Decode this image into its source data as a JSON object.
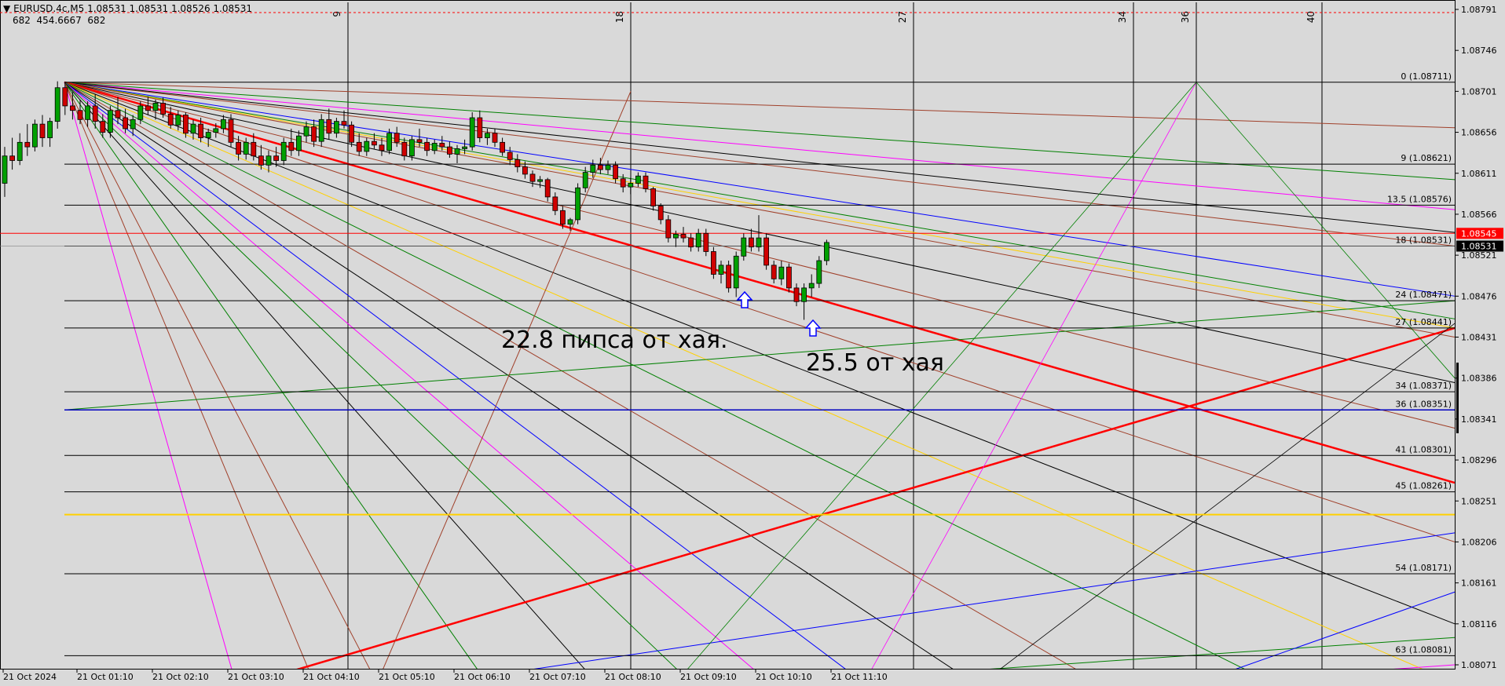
{
  "header": {
    "symbol": "EURUSD.4c,M5",
    "ohlc": "1.08531 1.08531 1.08526 1.08531",
    "indicator_values": "682  454.6667  682",
    "menu_marker": "▼"
  },
  "colors": {
    "background": "#d9d9d9",
    "bull_candle": "#00a000",
    "bear_candle": "#d00000",
    "ask_line": "#ff0000",
    "bid_tag": "#000000",
    "red_fan": "#ff0000",
    "blue_line": "#0000ff",
    "yellow_line": "#ffd000",
    "green_line": "#008000",
    "magenta_line": "#ff00ff",
    "brown_line": "#a0402a"
  },
  "chart_data": {
    "type": "candlestick",
    "title": "",
    "xlabel": "",
    "ylabel": "",
    "ylim": [
      1.08051,
      1.08801
    ],
    "grid": true,
    "price_axis": {
      "ticks": [
        "1.08791",
        "1.08746",
        "1.08701",
        "1.08656",
        "1.08611",
        "1.08566",
        "1.08521",
        "1.08476",
        "1.08431",
        "1.08386",
        "1.08341",
        "1.08296",
        "1.08251",
        "1.08206",
        "1.08161",
        "1.08116",
        "1.08071"
      ],
      "ask_tag": "1.08545",
      "bid_tag": "1.08531"
    },
    "time_axis": {
      "labels": [
        "21 Oct 2024",
        "21 Oct 01:10",
        "21 Oct 02:10",
        "21 Oct 03:10",
        "21 Oct 04:10",
        "21 Oct 05:10",
        "21 Oct 06:10",
        "21 Oct 07:10",
        "21 Oct 08:10",
        "21 Oct 09:10",
        "21 Oct 10:10",
        "21 Oct 11:10"
      ]
    },
    "time_marks": [
      "9",
      "18",
      "27",
      "34",
      "36",
      "40"
    ],
    "levels": [
      {
        "label": "0 (1.08711)",
        "price": 1.08711
      },
      {
        "label": "9 (1.08621)",
        "price": 1.08621
      },
      {
        "label": "13.5 (1.08576)",
        "price": 1.08576
      },
      {
        "label": "18 (1.08531)",
        "price": 1.08531
      },
      {
        "label": "24 (1.08471)",
        "price": 1.08471
      },
      {
        "label": "27 (1.08441)",
        "price": 1.08441
      },
      {
        "label": "34 (1.08371)",
        "price": 1.08371
      },
      {
        "label": "36 (1.08351)",
        "price": 1.08351
      },
      {
        "label": "41 (1.08301)",
        "price": 1.08301
      },
      {
        "label": "45 (1.08261)",
        "price": 1.08261
      },
      {
        "label": "54 (1.08171)",
        "price": 1.08171
      },
      {
        "label": "63 (1.08081)",
        "price": 1.08081
      }
    ],
    "series": [
      {
        "values": [
          [
            1.086,
            1.0864,
            1.08585,
            1.0863
          ],
          [
            1.0863,
            1.0865,
            1.08615,
            1.08625
          ],
          [
            1.08625,
            1.08655,
            1.0862,
            1.08645
          ],
          [
            1.08645,
            1.08665,
            1.0863,
            1.0864
          ],
          [
            1.0864,
            1.0867,
            1.08635,
            1.08665
          ],
          [
            1.08665,
            1.08675,
            1.0864,
            1.0865
          ],
          [
            1.0865,
            1.08672,
            1.0864,
            1.08668
          ],
          [
            1.08668,
            1.08712,
            1.0866,
            1.08705
          ],
          [
            1.08705,
            1.08711,
            1.08675,
            1.08685
          ],
          [
            1.08685,
            1.087,
            1.0867,
            1.0868
          ],
          [
            1.0868,
            1.08692,
            1.08665,
            1.0867
          ],
          [
            1.0867,
            1.0869,
            1.08662,
            1.08685
          ],
          [
            1.08685,
            1.08698,
            1.0866,
            1.08668
          ],
          [
            1.08668,
            1.08676,
            1.0865,
            1.08656
          ],
          [
            1.08656,
            1.08685,
            1.0865,
            1.0868
          ],
          [
            1.0868,
            1.08695,
            1.08665,
            1.08672
          ],
          [
            1.08672,
            1.08682,
            1.08655,
            1.0866
          ],
          [
            1.0866,
            1.08675,
            1.08652,
            1.0867
          ],
          [
            1.0867,
            1.0869,
            1.08665,
            1.08685
          ],
          [
            1.08685,
            1.08695,
            1.08675,
            1.0868
          ],
          [
            1.0868,
            1.08692,
            1.0867,
            1.08688
          ],
          [
            1.08688,
            1.08694,
            1.08672,
            1.08676
          ],
          [
            1.08676,
            1.08684,
            1.0866,
            1.08664
          ],
          [
            1.08664,
            1.0868,
            1.08658,
            1.08675
          ],
          [
            1.08675,
            1.08678,
            1.0865,
            1.08655
          ],
          [
            1.08655,
            1.0867,
            1.08648,
            1.08665
          ],
          [
            1.08665,
            1.08672,
            1.08645,
            1.0865
          ],
          [
            1.0865,
            1.0866,
            1.0864,
            1.08656
          ],
          [
            1.08656,
            1.08666,
            1.0865,
            1.0866
          ],
          [
            1.0866,
            1.08675,
            1.08655,
            1.0867
          ],
          [
            1.0867,
            1.08676,
            1.0864,
            1.08645
          ],
          [
            1.08645,
            1.08652,
            1.08625,
            1.08632
          ],
          [
            1.08632,
            1.0865,
            1.08626,
            1.08645
          ],
          [
            1.08645,
            1.08655,
            1.08625,
            1.0863
          ],
          [
            1.0863,
            1.08642,
            1.08615,
            1.0862
          ],
          [
            1.0862,
            1.08636,
            1.08612,
            1.0863
          ],
          [
            1.0863,
            1.0864,
            1.08618,
            1.08625
          ],
          [
            1.08625,
            1.0865,
            1.0862,
            1.08645
          ],
          [
            1.08645,
            1.0866,
            1.0863,
            1.08636
          ],
          [
            1.08636,
            1.08658,
            1.0863,
            1.08652
          ],
          [
            1.08652,
            1.08668,
            1.08645,
            1.08662
          ],
          [
            1.08662,
            1.0867,
            1.0864,
            1.08646
          ],
          [
            1.08646,
            1.08676,
            1.0864,
            1.0867
          ],
          [
            1.0867,
            1.08682,
            1.08648,
            1.08655
          ],
          [
            1.08655,
            1.08672,
            1.0865,
            1.08668
          ],
          [
            1.08668,
            1.0868,
            1.0866,
            1.08664
          ],
          [
            1.08664,
            1.08668,
            1.0864,
            1.08645
          ],
          [
            1.08645,
            1.08655,
            1.0863,
            1.08635
          ],
          [
            1.08635,
            1.0865,
            1.0863,
            1.08646
          ],
          [
            1.08646,
            1.08655,
            1.08638,
            1.08642
          ],
          [
            1.08642,
            1.0865,
            1.0863,
            1.08636
          ],
          [
            1.08636,
            1.0866,
            1.08632,
            1.08655
          ],
          [
            1.08655,
            1.08662,
            1.0864,
            1.08645
          ],
          [
            1.08645,
            1.0865,
            1.08625,
            1.0863
          ],
          [
            1.0863,
            1.08652,
            1.08625,
            1.08648
          ],
          [
            1.08648,
            1.0866,
            1.0864,
            1.08645
          ],
          [
            1.08645,
            1.0865,
            1.0863,
            1.08636
          ],
          [
            1.08636,
            1.08648,
            1.08632,
            1.08644
          ],
          [
            1.08644,
            1.08652,
            1.08636,
            1.0864
          ],
          [
            1.0864,
            1.08646,
            1.08628,
            1.08632
          ],
          [
            1.08632,
            1.08642,
            1.08622,
            1.08638
          ],
          [
            1.08638,
            1.08648,
            1.08632,
            1.0864
          ],
          [
            1.0864,
            1.08678,
            1.08636,
            1.08672
          ],
          [
            1.08672,
            1.0868,
            1.08645,
            1.0865
          ],
          [
            1.0865,
            1.0866,
            1.08642,
            1.08655
          ],
          [
            1.08655,
            1.0866,
            1.0864,
            1.08645
          ],
          [
            1.08645,
            1.0865,
            1.0863,
            1.08634
          ],
          [
            1.08634,
            1.0864,
            1.0862,
            1.08626
          ],
          [
            1.08626,
            1.08632,
            1.08612,
            1.08618
          ],
          [
            1.08618,
            1.08624,
            1.08605,
            1.0861
          ],
          [
            1.0861,
            1.08614,
            1.08596,
            1.08602
          ],
          [
            1.08602,
            1.08608,
            1.08595,
            1.08604
          ],
          [
            1.08604,
            1.08606,
            1.0858,
            1.08585
          ],
          [
            1.08585,
            1.0859,
            1.08565,
            1.0857
          ],
          [
            1.0857,
            1.08575,
            1.0855,
            1.08555
          ],
          [
            1.08555,
            1.08562,
            1.08548,
            1.0856
          ],
          [
            1.0856,
            1.086,
            1.08555,
            1.08595
          ],
          [
            1.08595,
            1.08618,
            1.0859,
            1.08612
          ],
          [
            1.08612,
            1.08626,
            1.08606,
            1.0862
          ],
          [
            1.0862,
            1.08628,
            1.0861,
            1.08615
          ],
          [
            1.08615,
            1.08625,
            1.0861,
            1.0862
          ],
          [
            1.0862,
            1.08624,
            1.086,
            1.08605
          ],
          [
            1.08605,
            1.0861,
            1.0859,
            1.08596
          ],
          [
            1.08596,
            1.08606,
            1.08588,
            1.086
          ],
          [
            1.086,
            1.08612,
            1.08596,
            1.08608
          ],
          [
            1.08608,
            1.08612,
            1.0859,
            1.08594
          ],
          [
            1.08594,
            1.08596,
            1.0857,
            1.08575
          ],
          [
            1.08575,
            1.08578,
            1.08555,
            1.0856
          ],
          [
            1.0856,
            1.08565,
            1.08535,
            1.0854
          ],
          [
            1.0854,
            1.08548,
            1.0853,
            1.08544
          ],
          [
            1.08544,
            1.08552,
            1.08535,
            1.0854
          ],
          [
            1.0854,
            1.08545,
            1.08525,
            1.0853
          ],
          [
            1.0853,
            1.0855,
            1.08525,
            1.08545
          ],
          [
            1.08545,
            1.0855,
            1.0852,
            1.08525
          ],
          [
            1.08525,
            1.0853,
            1.08495,
            1.085
          ],
          [
            1.085,
            1.08515,
            1.0849,
            1.0851
          ],
          [
            1.0851,
            1.08515,
            1.0848,
            1.08485
          ],
          [
            1.08485,
            1.08525,
            1.08475,
            1.0852
          ],
          [
            1.0852,
            1.08545,
            1.08515,
            1.0854
          ],
          [
            1.0854,
            1.0855,
            1.08525,
            1.0853
          ],
          [
            1.0853,
            1.08565,
            1.08525,
            1.0854
          ],
          [
            1.0854,
            1.08545,
            1.08505,
            1.0851
          ],
          [
            1.0851,
            1.08515,
            1.0849,
            1.08495
          ],
          [
            1.08495,
            1.08515,
            1.08488,
            1.08508
          ],
          [
            1.08508,
            1.08512,
            1.0848,
            1.08485
          ],
          [
            1.08485,
            1.0849,
            1.08465,
            1.0847
          ],
          [
            1.0847,
            1.0849,
            1.0845,
            1.08485
          ],
          [
            1.08485,
            1.085,
            1.08475,
            1.0849
          ],
          [
            1.0849,
            1.0852,
            1.08485,
            1.08515
          ],
          [
            1.08515,
            1.08538,
            1.0851,
            1.08535
          ]
        ]
      }
    ],
    "annotations": [
      {
        "text": "22.8 пипса от хая."
      },
      {
        "text": "25.5 от хая"
      }
    ]
  }
}
